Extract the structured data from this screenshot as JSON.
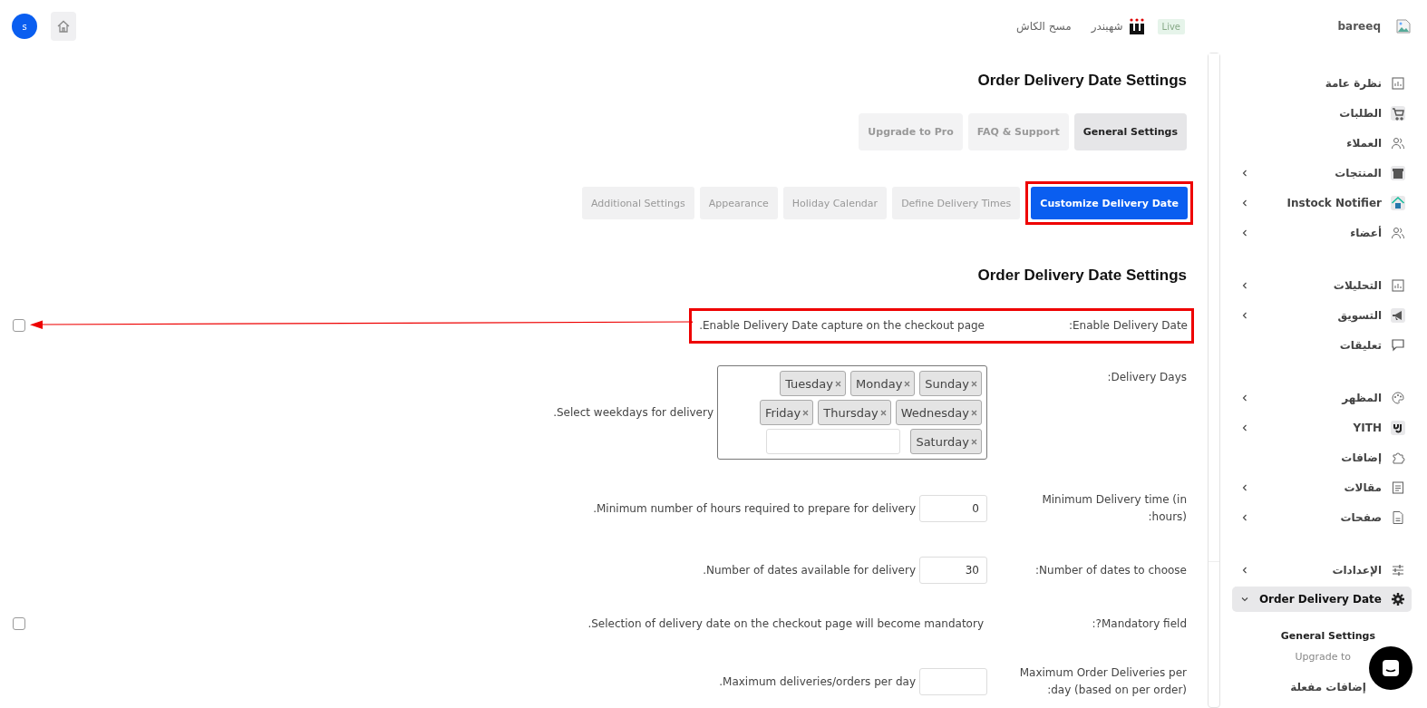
{
  "header": {
    "avatar": "s",
    "site": "bareeq",
    "live_badge": "Live",
    "brand": "شهبندر",
    "clear_cache": "مسح الكاش"
  },
  "page": {
    "title": "Order Delivery Date Settings",
    "tabs": [
      {
        "label": "Upgrade to Pro",
        "selected": false
      },
      {
        "label": "FAQ & Support",
        "selected": false
      },
      {
        "label": "General Settings",
        "selected": true
      }
    ],
    "subtabs": [
      {
        "label": "Additional Settings",
        "selected": false,
        "highlighted": false
      },
      {
        "label": "Appearance",
        "selected": false,
        "highlighted": false
      },
      {
        "label": "Holiday Calendar",
        "selected": false,
        "highlighted": false
      },
      {
        "label": "Define Delivery Times",
        "selected": false,
        "highlighted": false
      },
      {
        "label": "Customize Delivery Date",
        "selected": true,
        "highlighted": true
      }
    ],
    "section_title": "Order Delivery Date Settings",
    "rows": [
      {
        "kind": "checkbox",
        "label": ":Enable Delivery Date",
        "description": ".Enable Delivery Date capture on the checkout page",
        "checked": false,
        "highlighted": true,
        "arrow": true
      },
      {
        "kind": "tags",
        "label": ":Delivery Days",
        "description": ".Select weekdays for delivery",
        "tag_rows": [
          [
            "Tuesday",
            "Monday",
            "Sunday"
          ],
          [
            "Friday",
            "Thursday",
            "Wednesday"
          ],
          [
            "Saturday"
          ]
        ]
      },
      {
        "kind": "number",
        "label": "Minimum Delivery time (in :hours)",
        "description": ".Minimum number of hours required to prepare for delivery",
        "value": "0"
      },
      {
        "kind": "number",
        "label": ":Number of dates to choose",
        "description": ".Number of dates available for delivery",
        "value": "30"
      },
      {
        "kind": "checkbox",
        "label": ":?Mandatory field",
        "description": ".Selection of delivery date on the checkout page will become mandatory",
        "checked": false,
        "highlighted": false,
        "arrow": false
      },
      {
        "kind": "number",
        "label": "Maximum Order Deliveries per :day (based on per order)",
        "description": ".Maximum deliveries/orders per day"
      }
    ]
  },
  "sidebar": {
    "groups": [
      [
        {
          "label": "نظرة عامة",
          "selected": false
        },
        {
          "label": "الطلبات",
          "selected": false
        },
        {
          "label": "العملاء",
          "selected": false
        },
        {
          "label": "المنتجات",
          "selected": false,
          "expanded": false
        },
        {
          "label": "Instock Notifier",
          "selected": false,
          "expanded": false
        },
        {
          "label": "أعضاء",
          "selected": false,
          "expanded": false
        }
      ],
      [
        {
          "label": "التحليلات",
          "selected": false,
          "expanded": false
        },
        {
          "label": "التسويق",
          "selected": false,
          "expanded": false
        },
        {
          "label": "تعليقات",
          "selected": false
        }
      ],
      [
        {
          "label": "المظهر",
          "selected": false,
          "expanded": false
        },
        {
          "label": "YITH",
          "selected": false,
          "expanded": false
        },
        {
          "label": "إضافات",
          "selected": false
        },
        {
          "label": "مقالات",
          "selected": false,
          "expanded": false
        },
        {
          "label": "صفحات",
          "selected": false,
          "expanded": false
        }
      ],
      [
        {
          "label": "الإعدادات",
          "selected": false,
          "expanded": false
        },
        {
          "label": "Order Delivery Date",
          "selected": true,
          "expanded": true,
          "children": [
            {
              "label": "General Settings",
              "selected": true
            },
            {
              "label": "Upgrade to",
              "selected": false
            }
          ]
        },
        {
          "label": "إضافات مفعلة",
          "selected": false
        }
      ]
    ]
  }
}
